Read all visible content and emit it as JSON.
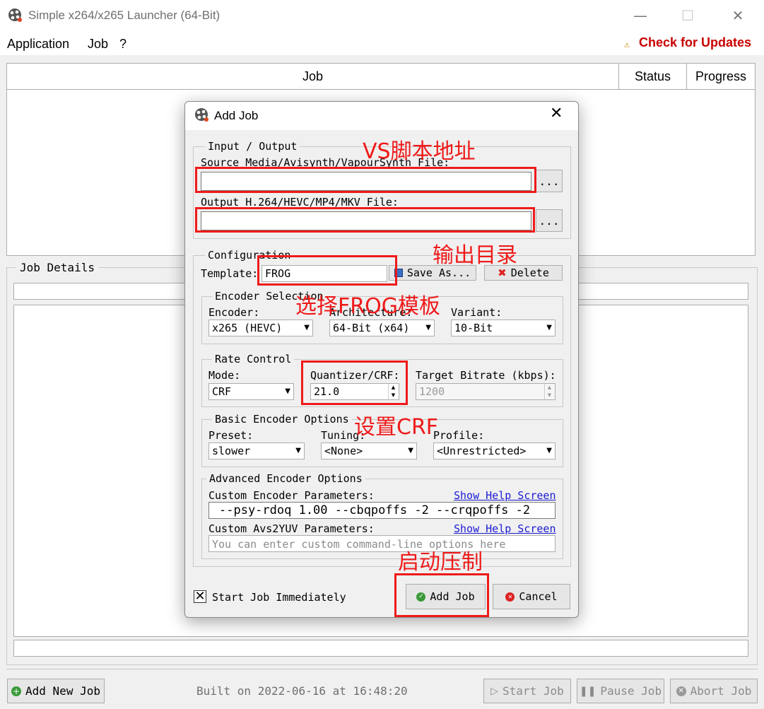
{
  "window": {
    "title": "Simple x264/x265 Launcher (64-Bit)",
    "minimize": "—",
    "maximize": "☐",
    "close": "✕"
  },
  "menu": {
    "items": [
      "Application",
      "Job",
      "?"
    ],
    "update_icon": "⚠",
    "update_link": "Check for Updates"
  },
  "job_table": {
    "columns": [
      "Job",
      "Status",
      "Progress"
    ]
  },
  "job_details": {
    "legend": "Job Details"
  },
  "footer": {
    "add_new_job": "Add New Job",
    "built": "Built on 2022-06-16 at 16:48:20",
    "start_job": "Start Job",
    "pause_job": "Pause Job",
    "abort_job": "Abort Job"
  },
  "dialog": {
    "title": "Add Job",
    "close": "✕",
    "io": {
      "legend": "Input / Output",
      "source_label": "Source Media/Avisynth/VapourSynth File:",
      "source_value": "",
      "output_label": "Output H.264/HEVC/MP4/MKV File:",
      "output_value": "",
      "browse": "..."
    },
    "config": {
      "legend": "Configuration",
      "template_label": "Template:",
      "template_value": "FROG",
      "save_as": "Save As...",
      "delete": "Delete"
    },
    "encoder": {
      "legend": "Encoder Selection",
      "encoder_label": "Encoder:",
      "encoder_value": "x265 (HEVC)",
      "arch_label": "Architecture:",
      "arch_value": "64-Bit (x64)",
      "variant_label": "Variant:",
      "variant_value": "10-Bit"
    },
    "rate": {
      "legend": "Rate Control",
      "mode_label": "Mode:",
      "mode_value": "CRF",
      "crf_label": "Quantizer/CRF:",
      "crf_value": "21.0",
      "bitrate_label": "Target Bitrate (kbps):",
      "bitrate_value": "1200"
    },
    "basic": {
      "legend": "Basic Encoder Options",
      "preset_label": "Preset:",
      "preset_value": "slower",
      "tuning_label": "Tuning:",
      "tuning_value": "<None>",
      "profile_label": "Profile:",
      "profile_value": "<Unrestricted>"
    },
    "advanced": {
      "legend": "Advanced Encoder Options",
      "custom_enc_label": "Custom Encoder Parameters:",
      "custom_enc_value": "--psy-rdoq 1.00 --cbqpoffs -2 --crqpoffs -2",
      "custom_avs_label": "Custom Avs2YUV Parameters:",
      "custom_avs_placeholder": "You can enter custom command-line options here",
      "help_link": "Show Help Screen"
    },
    "start_immediately_label": "Start Job Immediately",
    "start_immediately_checked": true,
    "add_job": "Add Job",
    "cancel": "Cancel"
  },
  "annotations": {
    "vs_script": "VS脚本地址",
    "output_dir": "输出目录",
    "frog_template": "选择FROG模板",
    "set_crf": "设置CRF",
    "start_encode": "启动压制",
    "color": "#ef1a1a"
  }
}
